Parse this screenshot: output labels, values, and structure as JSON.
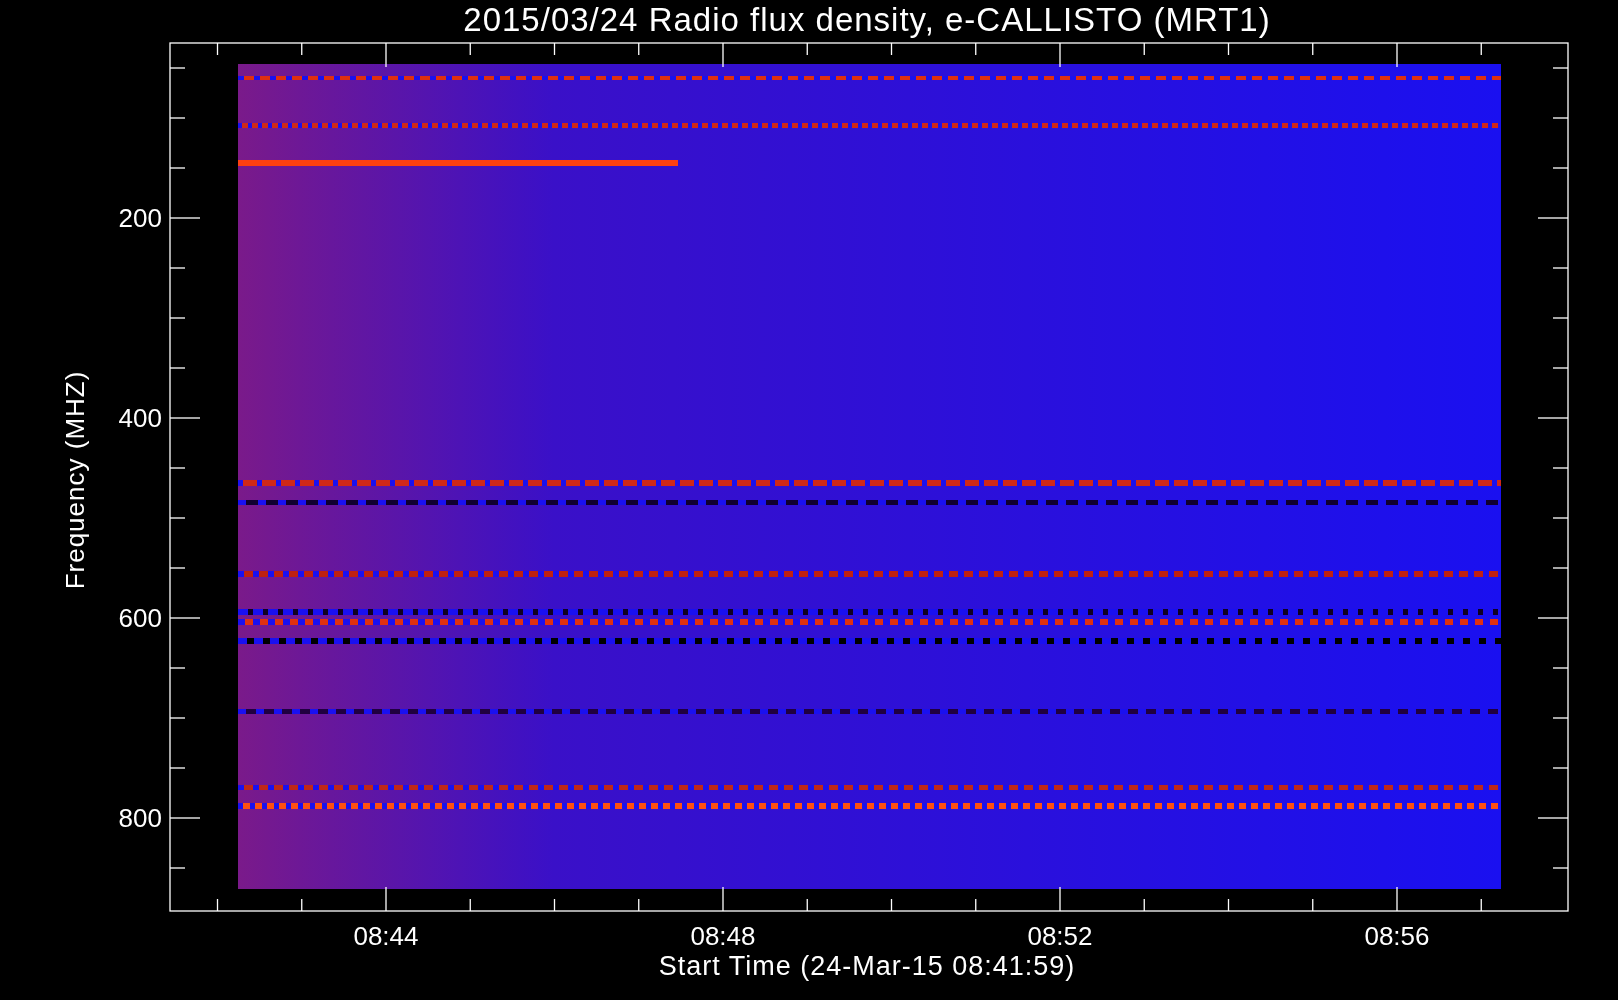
{
  "title": "2015/03/24  Radio flux density, e-CALLISTO (MRT1)",
  "y_axis": {
    "label": "Frequency (MHZ)",
    "tick_labels": [
      "200",
      "400",
      "600",
      "800"
    ]
  },
  "x_axis": {
    "label": "Start Time (24-Mar-15 08:41:59)",
    "tick_labels": [
      "08:44",
      "08:48",
      "08:52",
      "08:56"
    ]
  }
}
